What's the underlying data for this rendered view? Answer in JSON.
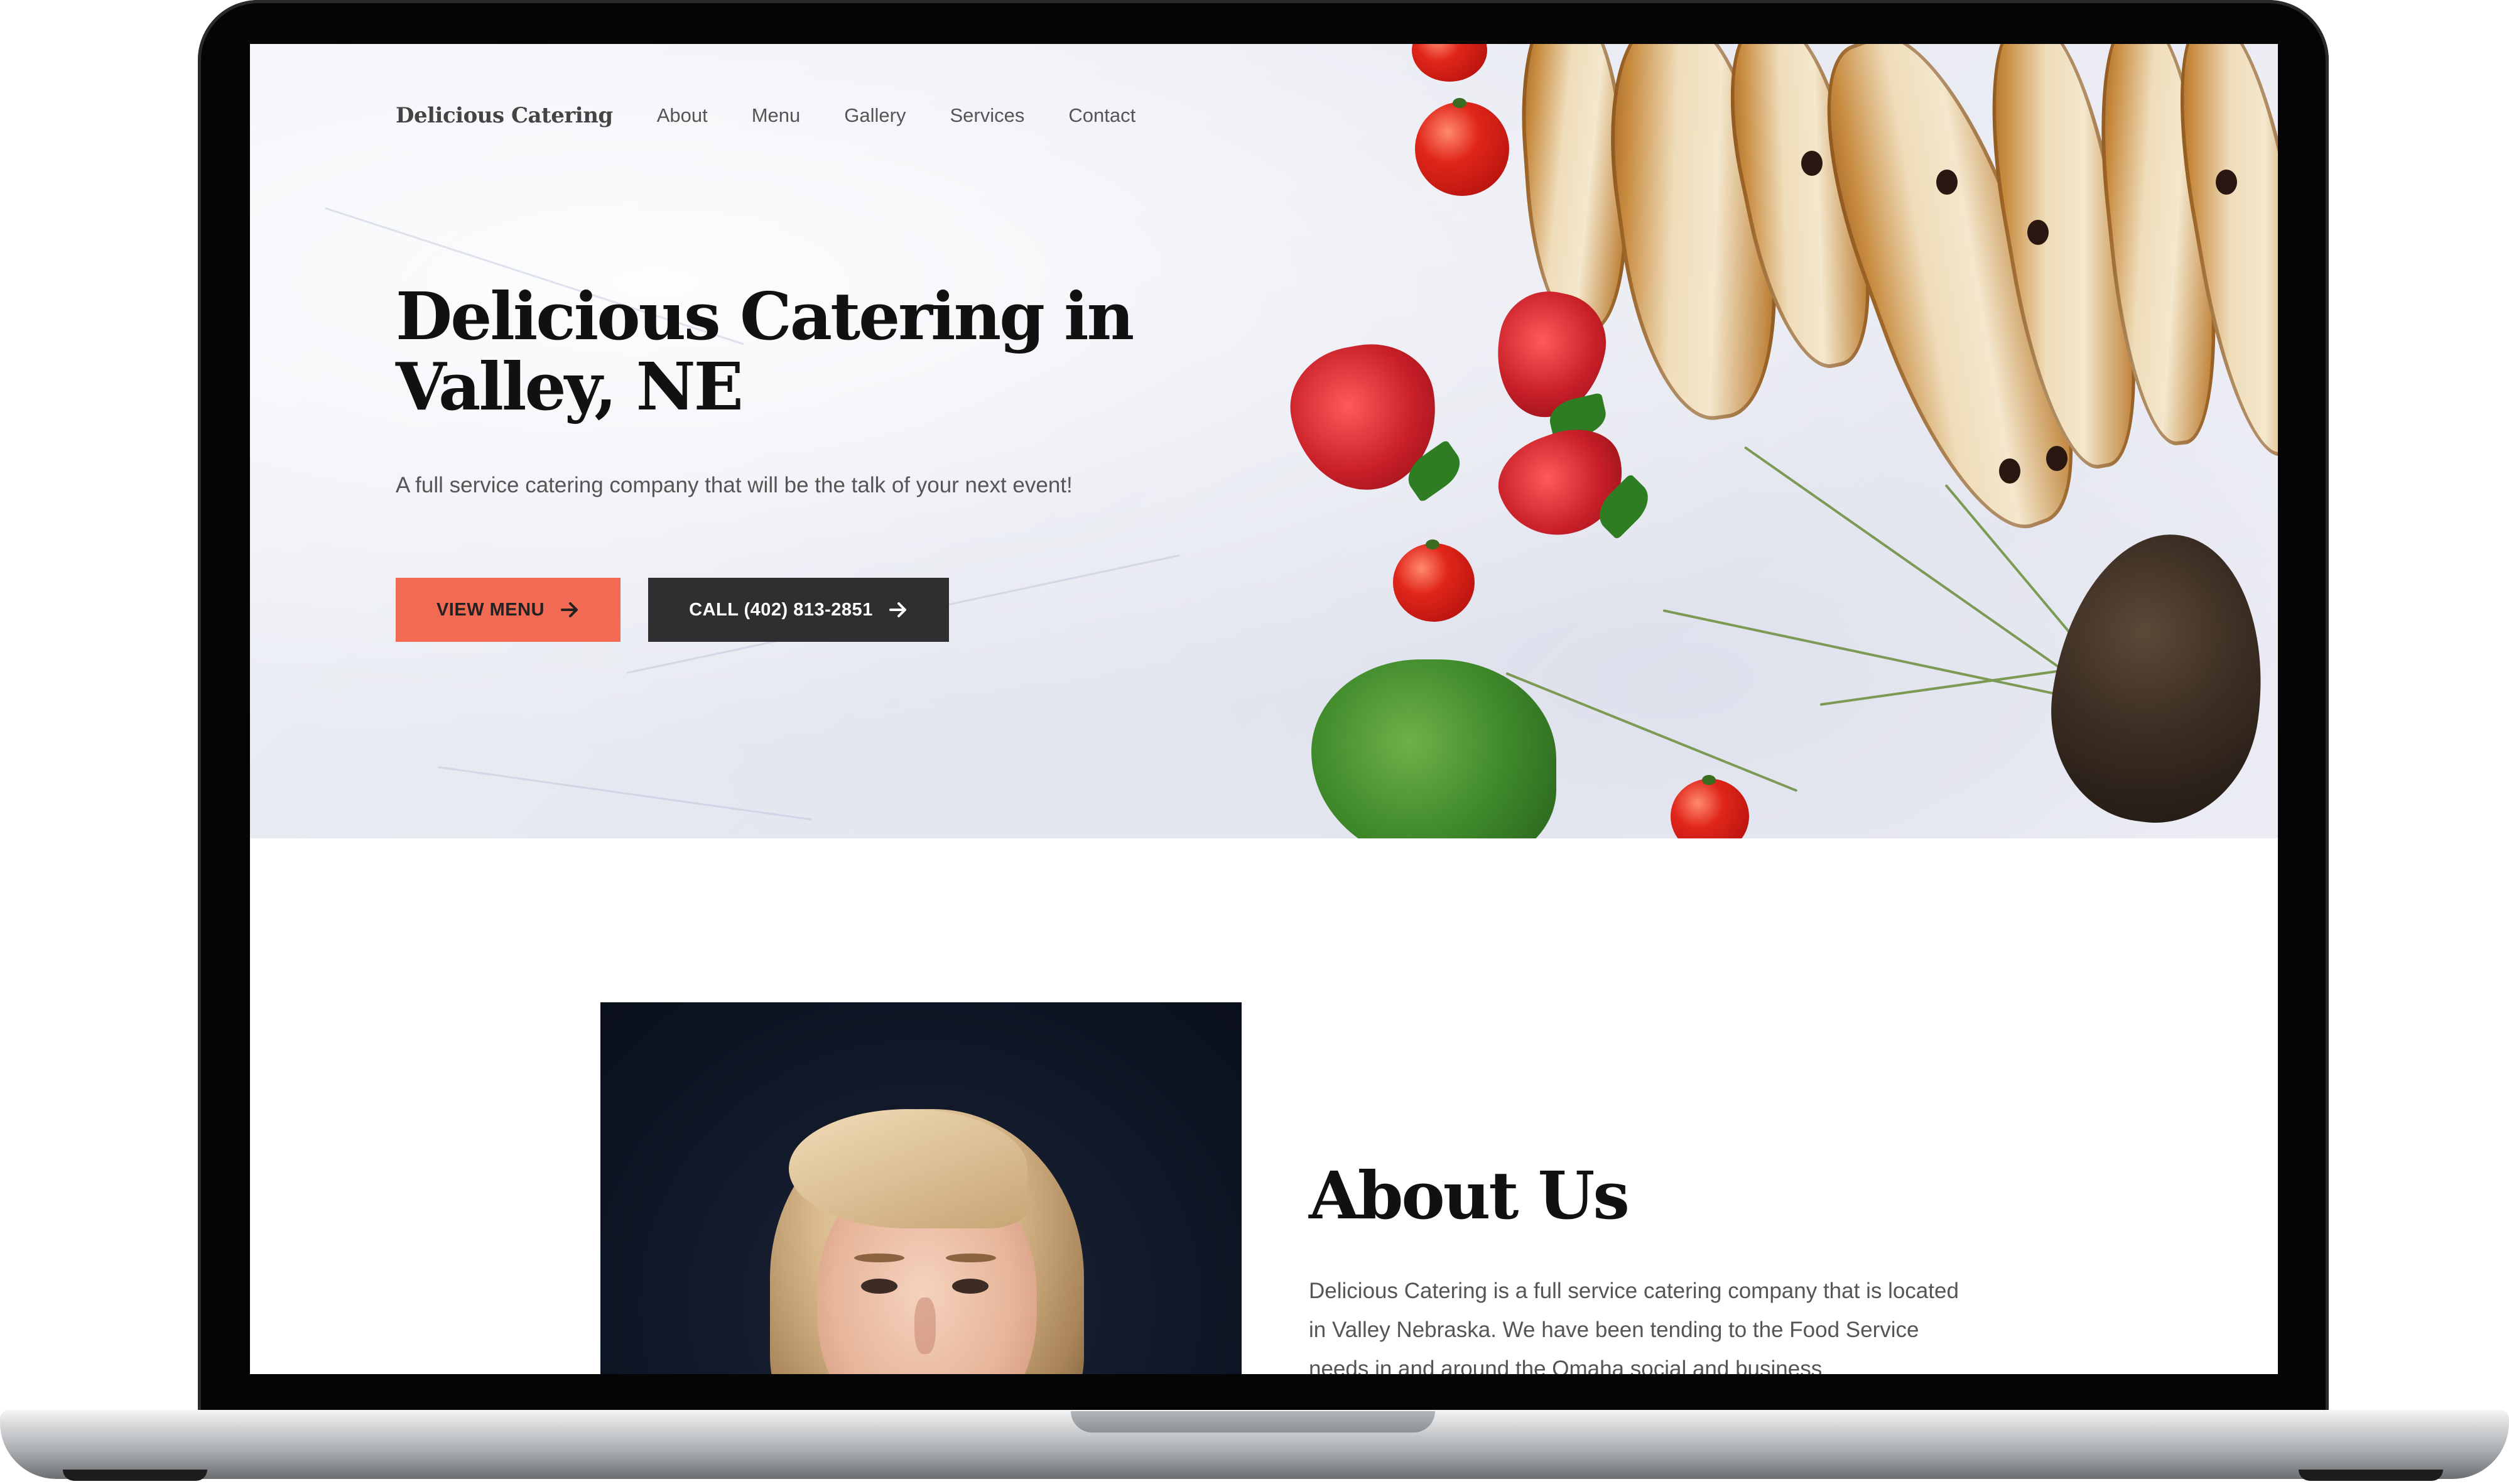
{
  "nav": {
    "logo": "Delicious Catering",
    "links": [
      "About",
      "Menu",
      "Gallery",
      "Services",
      "Contact"
    ]
  },
  "hero": {
    "title": "Delicious Catering in Valley, NE",
    "subtitle": "A full service catering company that will be the talk of your next event!",
    "buttons": {
      "menu_label": "VIEW MENU",
      "call_label": "CALL (402) 813-2851"
    }
  },
  "about": {
    "title": "About Us",
    "text": "Delicious Catering is a full service catering company that is located in Valley Nebraska. We have been tending to the Food Service needs in and around the Omaha social and business"
  },
  "colors": {
    "accent": "#f26a54",
    "dark_button": "#2f2f31",
    "heading": "#111111",
    "body_text": "#555555"
  },
  "icons": {
    "button_arrow": "arrow-right-icon"
  }
}
